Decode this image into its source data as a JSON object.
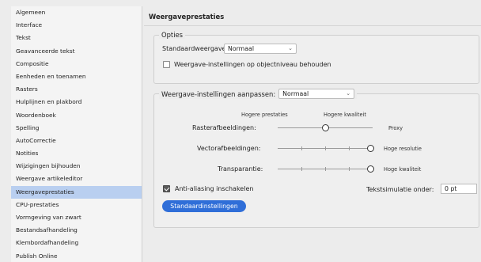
{
  "sidebar": {
    "items": [
      {
        "label": "Algemeen"
      },
      {
        "label": "Interface"
      },
      {
        "label": "Tekst"
      },
      {
        "label": "Geavanceerde tekst"
      },
      {
        "label": "Compositie"
      },
      {
        "label": "Eenheden en toenamen"
      },
      {
        "label": "Rasters"
      },
      {
        "label": "Hulplijnen en plakbord"
      },
      {
        "label": "Woordenboek"
      },
      {
        "label": "Spelling"
      },
      {
        "label": "AutoCorrectie"
      },
      {
        "label": "Notities"
      },
      {
        "label": "Wijzigingen bijhouden"
      },
      {
        "label": "Weergave artikeleditor"
      },
      {
        "label": "Weergaveprestaties"
      },
      {
        "label": "CPU-prestaties"
      },
      {
        "label": "Vormgeving van zwart"
      },
      {
        "label": "Bestandsafhandeling"
      },
      {
        "label": "Klembordafhandeling"
      },
      {
        "label": "Publish Online"
      }
    ],
    "selected_index": 14
  },
  "page_title": "Weergaveprestaties",
  "options": {
    "legend": "Opties",
    "default_view_label": "Standaardweergave:",
    "default_view_value": "Normaal",
    "preserve_label": "Weergave-instellingen op objectniveau behouden",
    "preserve_checked": false
  },
  "adjust": {
    "legend_label": "Weergave-instellingen aanpassen:",
    "legend_value": "Normaal",
    "higher_performance": "Hogere prestaties",
    "higher_quality": "Hogere kwaliteit",
    "raster_label": "Rasterafbeeldingen:",
    "raster_value_label": "Proxy",
    "raster_level": 0.5,
    "vector_label": "Vectorafbeeldingen:",
    "vector_value_label": "Hoge resolutie",
    "vector_level": 1.0,
    "transparency_label": "Transparantie:",
    "transparency_value_label": "Hoge kwaliteit",
    "transparency_level": 1.0,
    "antialias_label": "Anti-aliasing inschakelen",
    "antialias_checked": true,
    "greek_label": "Tekstsimulatie onder:",
    "greek_value": "0 pt",
    "defaults_button": "Standaardinstellingen"
  },
  "colors": {
    "selection": "#b9cff0",
    "button": "#2f6ed8"
  }
}
